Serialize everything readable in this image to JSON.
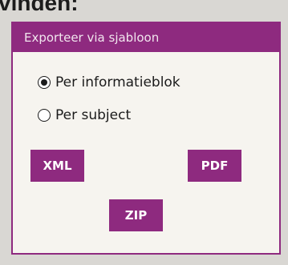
{
  "background": {
    "heading": "vinden:"
  },
  "dialog": {
    "title": "Exporteer via sjabloon",
    "options": [
      {
        "label": "Per informatieblok",
        "checked": true
      },
      {
        "label": "Per subject",
        "checked": false
      }
    ],
    "buttons": {
      "xml": "XML",
      "pdf": "PDF",
      "zip": "ZIP"
    }
  },
  "colors": {
    "accent": "#8e2a7f",
    "dialog_bg": "#f6f4ef",
    "page_bg": "#d9d7d3"
  }
}
